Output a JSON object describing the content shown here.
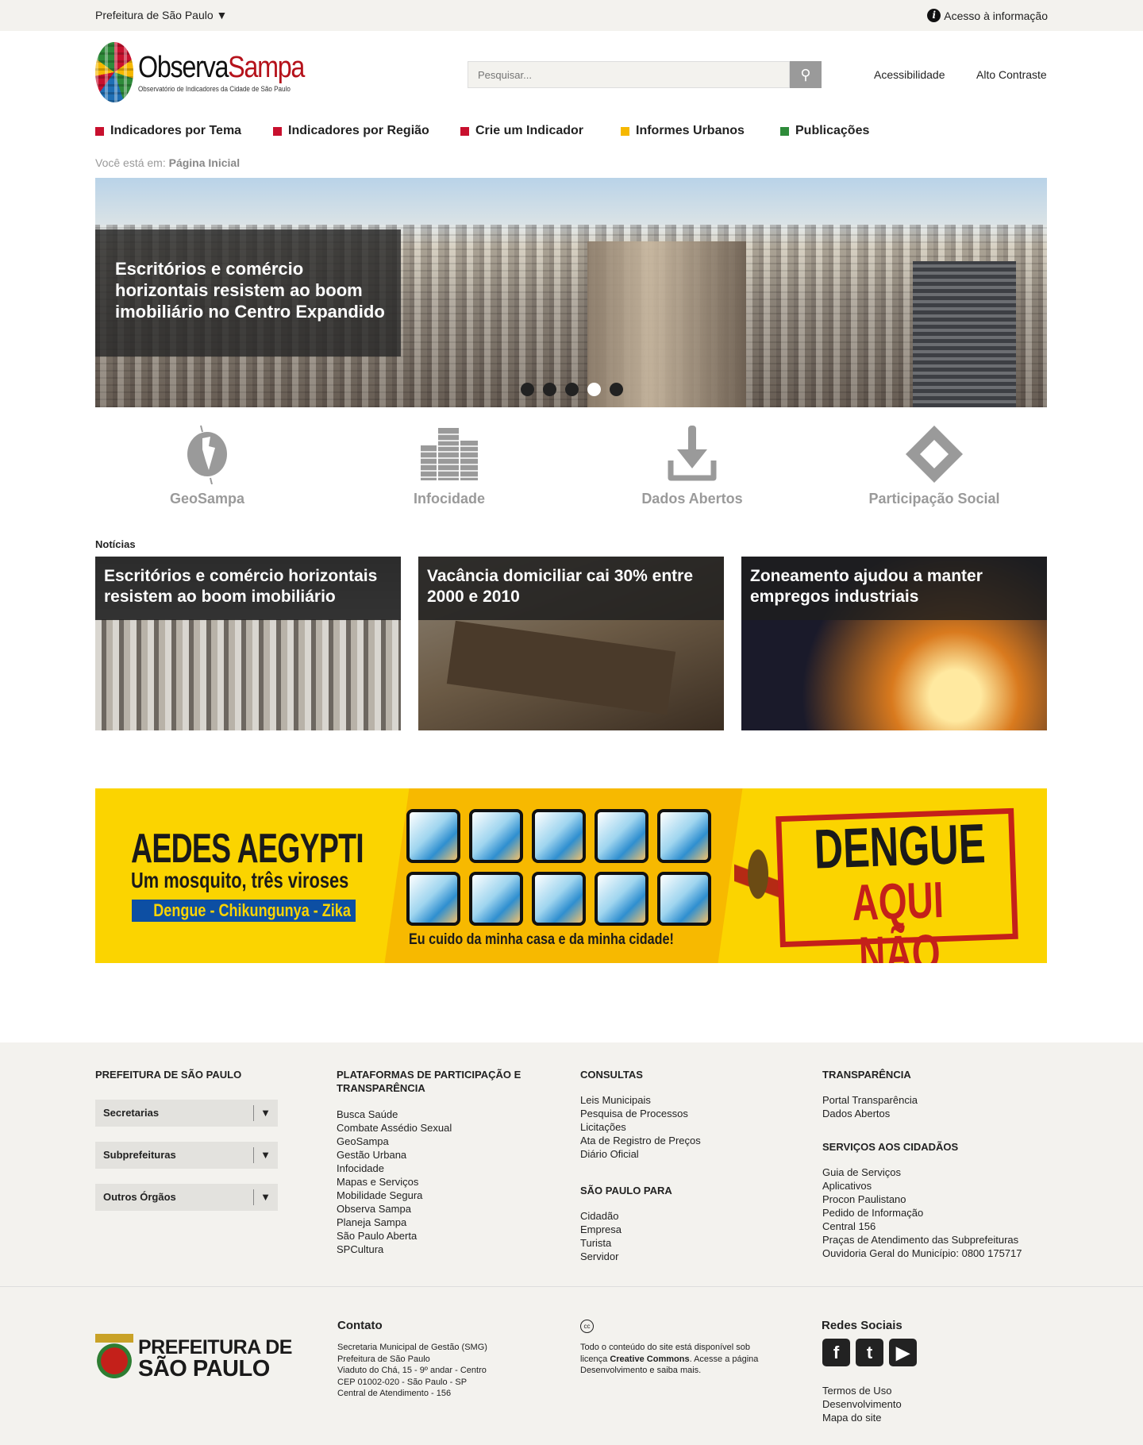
{
  "topbar": {
    "prefeitura": "Prefeitura de São Paulo ▼",
    "acesso": "Acesso à informação",
    "info_icon": "i"
  },
  "header": {
    "logo_a": "Observa",
    "logo_b": "Sampa",
    "logo_sub": "Observatório de Indicadores da Cidade de São Paulo",
    "search_placeholder": "Pesquisar...",
    "search_icon": "⚲",
    "acessibilidade": "Acessibilidade",
    "alto_contraste": "Alto Contraste"
  },
  "nav": [
    {
      "label": "Indicadores por Tema",
      "color": "#c8102e"
    },
    {
      "label": "Indicadores por Região",
      "color": "#c8102e"
    },
    {
      "label": "Crie um Indicador",
      "color": "#c8102e"
    },
    {
      "label": "Informes Urbanos",
      "color": "#f6b800"
    },
    {
      "label": "Publicações",
      "color": "#2e8b3a"
    }
  ],
  "breadcrumb": {
    "prefix": "Você está em:",
    "current": "Página Inicial"
  },
  "hero": {
    "title": "Escritórios e comércio horizontais resistem ao boom imobiliário no Centro Expandido",
    "slides": 5,
    "active_slide": 4
  },
  "quicklinks": [
    {
      "label": "GeoSampa",
      "icon": "globe-map"
    },
    {
      "label": "Infocidade",
      "icon": "buildings"
    },
    {
      "label": "Dados Abertos",
      "icon": "download"
    },
    {
      "label": "Participação Social",
      "icon": "hands"
    }
  ],
  "news": {
    "label": "Notícias",
    "items": [
      {
        "title": "Escritórios e comércio horizontais resistem ao boom imobiliário"
      },
      {
        "title": "Vacância domiciliar cai 30% entre 2000 e 2010"
      },
      {
        "title": "Zoneamento ajudou a manter empregos industriais"
      }
    ]
  },
  "banner": {
    "headline": "AEDES AEGYPTI",
    "subhead": "Um mosquito, três viroses",
    "diseases": "Dengue - Chikungunya - Zika",
    "caption": "Eu cuido da minha casa e da minha cidade!",
    "stamp_1": "DENGUE",
    "stamp_2": "AQUI NÃO"
  },
  "footer": {
    "col1": {
      "heading": "PREFEITURA DE SÃO PAULO",
      "dropdowns": [
        "Secretarias",
        "Subprefeituras",
        "Outros Órgãos"
      ]
    },
    "col2": {
      "heading": "PLATAFORMAS DE PARTICIPAÇÃO E TRANSPARÊNCIA",
      "links": [
        "Busca Saúde",
        "Combate Assédio Sexual",
        "GeoSampa",
        "Gestão Urbana",
        "Infocidade",
        "Mapas e Serviços",
        "Mobilidade Segura",
        "Observa Sampa",
        "Planeja Sampa",
        "São Paulo Aberta",
        "SPCultura"
      ]
    },
    "col3": {
      "heading": "CONSULTAS",
      "links": [
        "Leis Municipais",
        "Pesquisa de Processos",
        "Licitações",
        "Ata de Registro de Preços",
        "Diário Oficial"
      ],
      "heading2": "SÃO PAULO PARA",
      "links2": [
        "Cidadão",
        "Empresa",
        "Turista",
        "Servidor"
      ]
    },
    "col4": {
      "heading": "TRANSPARÊNCIA",
      "links": [
        "Portal Transparência",
        "Dados Abertos"
      ],
      "heading2": "SERVIÇOS AOS CIDADÃOS",
      "links2": [
        "Guia de Serviços",
        "Aplicativos",
        "Procon Paulistano",
        "Pedido de Informação",
        "Central 156",
        "Praças de Atendimento das Subprefeituras",
        "Ouvidoria Geral do Município: 0800 175717"
      ]
    },
    "bottom": {
      "logo_line1": "PREFEITURA DE",
      "logo_line2": "SÃO PAULO",
      "contato_heading": "Contato",
      "contato_lines": [
        "Secretaria Municipal de Gestão (SMG)",
        "Prefeitura de São Paulo",
        "Viaduto do Chá, 15 - 9º andar - Centro",
        "CEP 01002-020 - São Paulo - SP",
        "Central de Atendimento - 156"
      ],
      "cc_icon": "cc",
      "cc_text_1": "Todo o conteúdo do site está disponível sob licença",
      "cc_link": "Creative Commons",
      "cc_text_2": ". Acesse a página Desenvolvimento e saiba mais.",
      "social_heading": "Redes Sociais",
      "social": [
        "f",
        "t",
        "▶"
      ],
      "links": [
        "Termos de Uso",
        "Desenvolvimento",
        "Mapa do site"
      ]
    }
  }
}
